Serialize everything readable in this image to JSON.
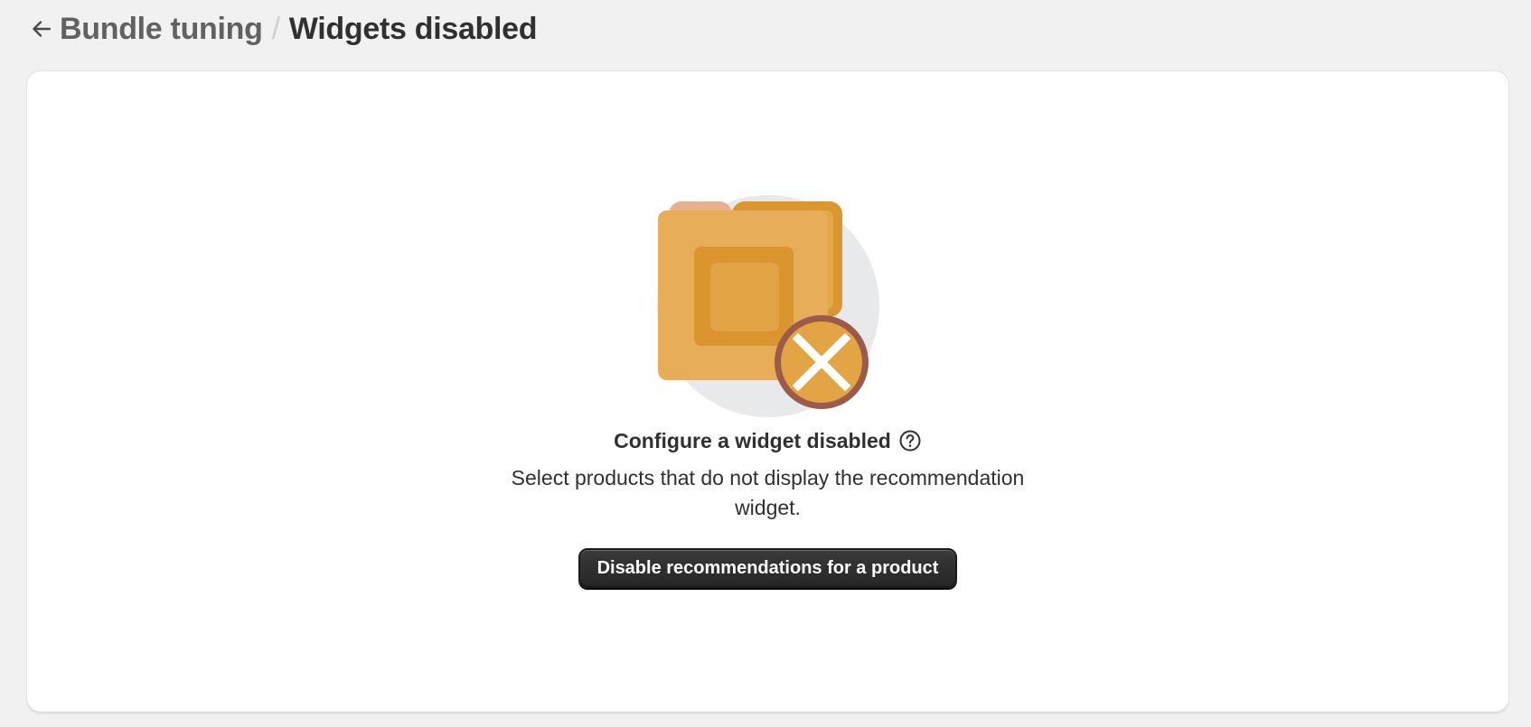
{
  "header": {
    "back_icon": "arrow-left-icon",
    "breadcrumb_parent": "Bundle tuning",
    "breadcrumb_separator": "/",
    "page_title": "Widgets disabled"
  },
  "empty_state": {
    "illustration_icon": "folder-disabled-illustration",
    "title": "Configure a widget disabled",
    "help_icon": "question-circle-icon",
    "description": "Select products that do not display the recommendation widget.",
    "action_label": "Disable recommendations for a product"
  },
  "colors": {
    "page_background": "#f1f1f1",
    "card_background": "#ffffff",
    "primary_button": "#303030",
    "folder_front": "#e8ad58",
    "folder_back": "#dc962f",
    "badge_border": "#9c5a4a",
    "illustration_circle": "#e8e9eb"
  }
}
